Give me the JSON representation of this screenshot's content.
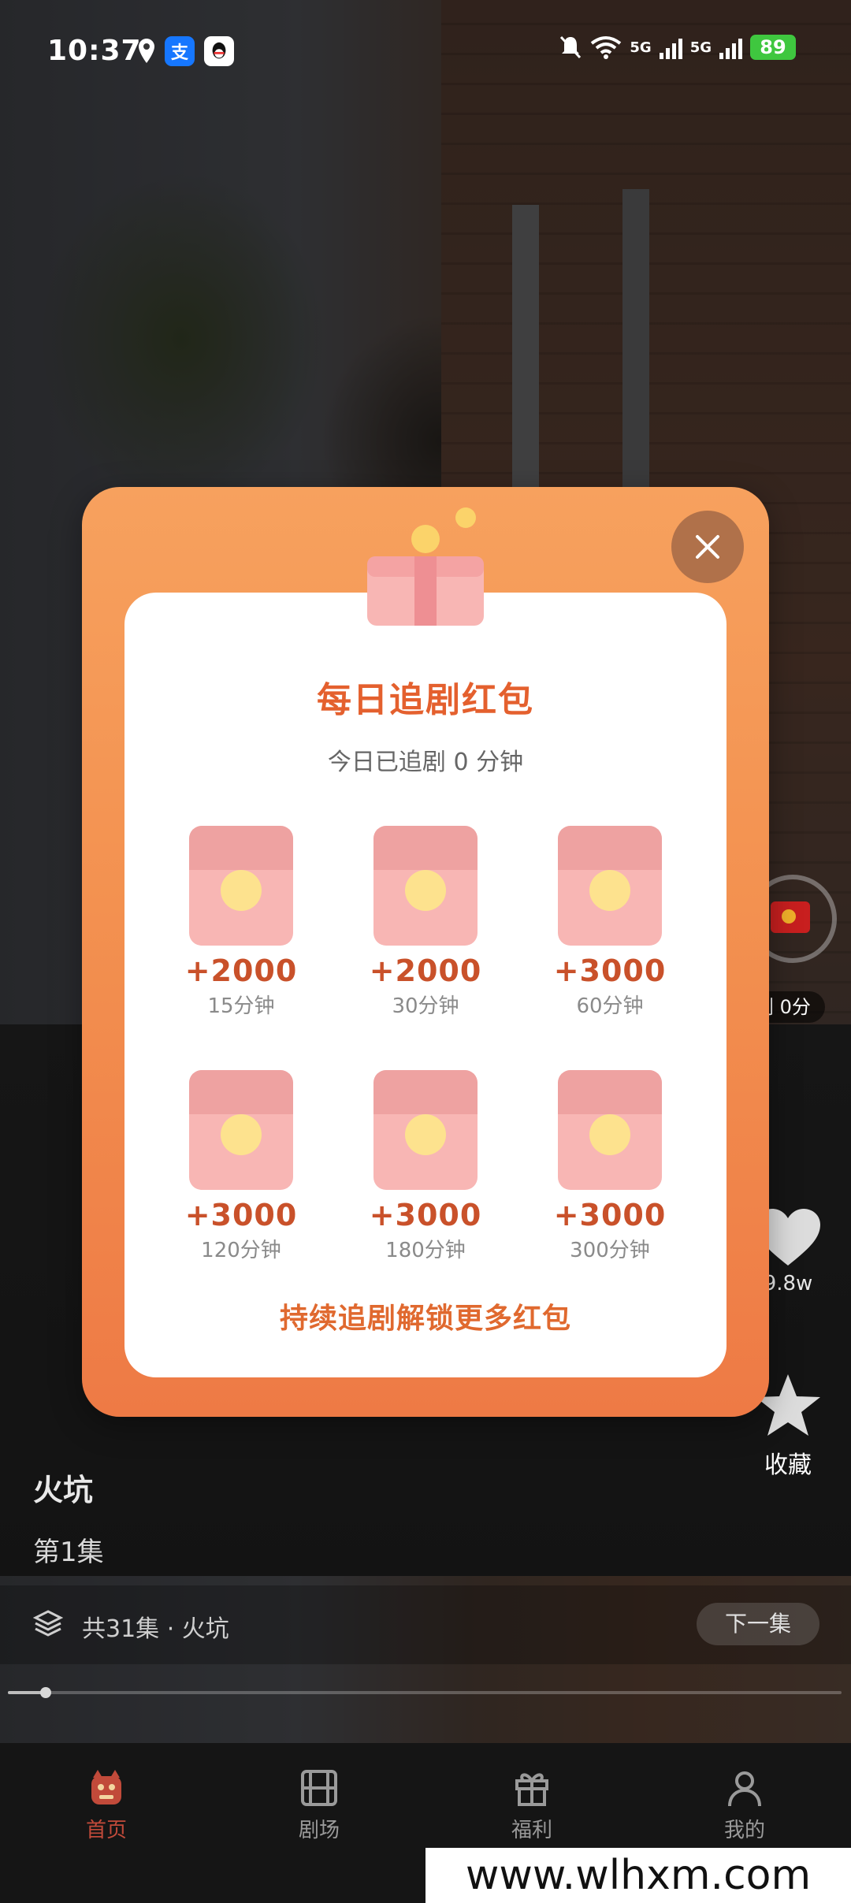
{
  "status_bar": {
    "time": "10:37",
    "alipay_glyph": "支",
    "battery": "89",
    "net_label_1": "5G",
    "net_label_2": "5G"
  },
  "modal": {
    "title": "每日追剧红包",
    "subtitle": "今日已追剧 0 分钟",
    "rewards": [
      {
        "amount": "+2000",
        "time": "15分钟"
      },
      {
        "amount": "+2000",
        "time": "30分钟"
      },
      {
        "amount": "+3000",
        "time": "60分钟"
      },
      {
        "amount": "+3000",
        "time": "120分钟"
      },
      {
        "amount": "+3000",
        "time": "180分钟"
      },
      {
        "amount": "+3000",
        "time": "300分钟"
      }
    ],
    "footer": "持续追剧解锁更多红包"
  },
  "side_actions": {
    "timer_text": "剧 0分",
    "like_count": "9.8w",
    "favorite_label": "收藏"
  },
  "video": {
    "title": "火坑",
    "episode": "第1集",
    "series_info": "共31集 · 火坑",
    "next_label": "下一集",
    "progress_fraction": 0.045
  },
  "nav": {
    "items": [
      {
        "label": "首页",
        "icon": "home-mascot-icon",
        "active": true
      },
      {
        "label": "剧场",
        "icon": "film-icon",
        "active": false
      },
      {
        "label": "福利",
        "icon": "gift-icon",
        "active": false
      },
      {
        "label": "我的",
        "icon": "user-icon",
        "active": false
      }
    ]
  },
  "watermark": "www.wlhxm.com",
  "colors": {
    "accent_orange": "#e4602e",
    "modal_gradient_top": "#f7a15e",
    "envelope_pink": "#f8b6b4",
    "coin_yellow": "#fde28e",
    "nav_active": "#c14a3a"
  }
}
